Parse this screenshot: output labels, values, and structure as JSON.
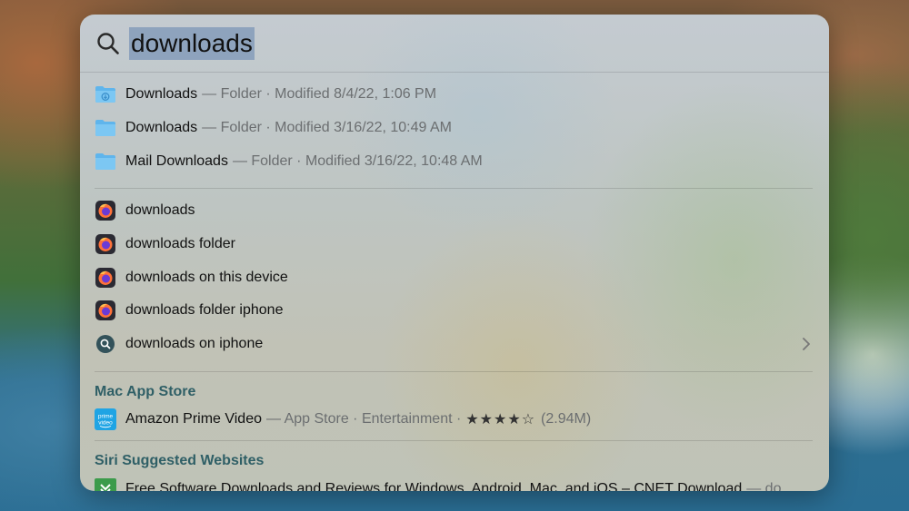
{
  "search": {
    "query": "downloads"
  },
  "folders": [
    {
      "title": "Downloads",
      "meta": "— Folder · Modified 8/4/22, 1:06 PM",
      "icon": "downloads-folder-icon"
    },
    {
      "title": "Downloads",
      "meta": "— Folder · Modified 3/16/22, 10:49 AM",
      "icon": "folder-icon"
    },
    {
      "title": "Mail Downloads",
      "meta": "— Folder · Modified 3/16/22, 10:48 AM",
      "icon": "folder-icon"
    }
  ],
  "suggestions": [
    {
      "title": "downloads",
      "icon": "firefox-icon"
    },
    {
      "title": "downloads folder",
      "icon": "firefox-icon"
    },
    {
      "title": "downloads on this device",
      "icon": "firefox-icon"
    },
    {
      "title": "downloads folder iphone",
      "icon": "firefox-icon"
    },
    {
      "title": "downloads on iphone",
      "icon": "web-search-icon"
    }
  ],
  "app_store": {
    "header": "Mac App Store",
    "app_title": "Amazon Prime Video",
    "app_meta": "— App Store · Entertainment ·",
    "rating_stars": 4.5,
    "stars_text": "★★★★☆",
    "rating_count": "(2.94M)",
    "icon_text_top": "prime",
    "icon_text_bottom": "video"
  },
  "siri_websites": {
    "header": "Siri Suggested Websites",
    "items": [
      {
        "title": "Free Software Downloads and Reviews for Windows, Android, Mac, and iOS – CNET Download",
        "meta": "— do"
      }
    ]
  },
  "colors": {
    "accent_header": "#2f5f66",
    "selection": "#8ea3bd",
    "folder_blue": "#5fb5ec",
    "firefox_orange": "#ff7139",
    "firefox_purple": "#6a3bd6"
  }
}
